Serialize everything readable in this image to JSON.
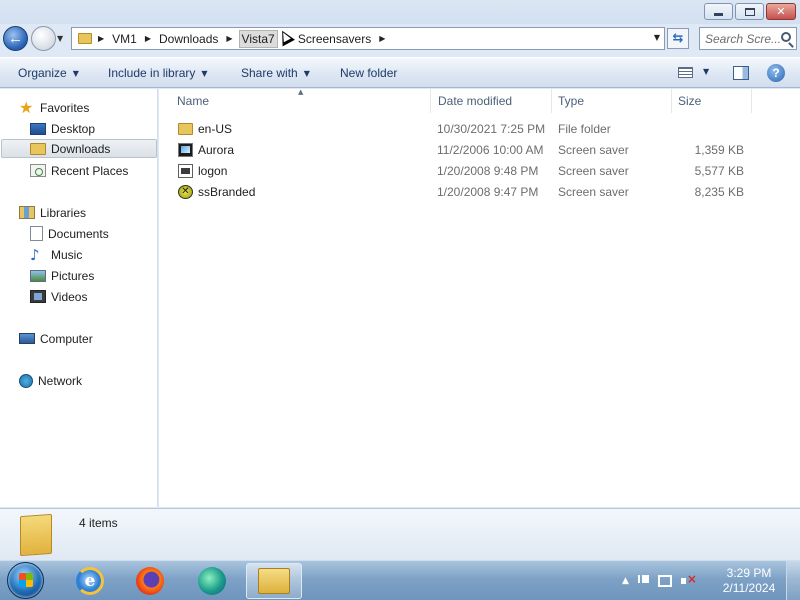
{
  "window": {
    "controls": {
      "minimize": "minimize",
      "maximize": "maximize",
      "close": "close"
    }
  },
  "navigation": {
    "back_icon": "back-arrow-icon",
    "forward_icon": "forward-arrow-icon",
    "breadcrumb": [
      "VM1",
      "Downloads",
      "Vista7",
      "Screensavers"
    ],
    "search_placeholder": "Search Scre..."
  },
  "toolbar": {
    "organize": "Organize",
    "include_in_library": "Include in library",
    "share_with": "Share with",
    "new_folder": "New folder"
  },
  "sidebar": {
    "favorites": {
      "label": "Favorites",
      "items": [
        "Desktop",
        "Downloads",
        "Recent Places"
      ]
    },
    "libraries": {
      "label": "Libraries",
      "items": [
        "Documents",
        "Music",
        "Pictures",
        "Videos"
      ]
    },
    "computer": "Computer",
    "network": "Network",
    "selected": "Downloads"
  },
  "file_list": {
    "columns": [
      "Name",
      "Date modified",
      "Type",
      "Size"
    ],
    "rows": [
      {
        "name": "en-US",
        "date": "10/30/2021 7:25 PM",
        "type": "File folder",
        "size": "",
        "icon": "folder-icon"
      },
      {
        "name": "Aurora",
        "date": "11/2/2006 10:00 AM",
        "type": "Screen saver",
        "size": "1,359 KB",
        "icon": "screensaver-aurora-icon"
      },
      {
        "name": "logon",
        "date": "1/20/2008 9:48 PM",
        "type": "Screen saver",
        "size": "5,577 KB",
        "icon": "screensaver-logon-icon"
      },
      {
        "name": "ssBranded",
        "date": "1/20/2008 9:47 PM",
        "type": "Screen saver",
        "size": "8,235 KB",
        "icon": "screensaver-branded-icon"
      }
    ]
  },
  "details": {
    "item_count": "4 items"
  },
  "taskbar": {
    "time": "3:29 PM",
    "date": "2/11/2024"
  }
}
